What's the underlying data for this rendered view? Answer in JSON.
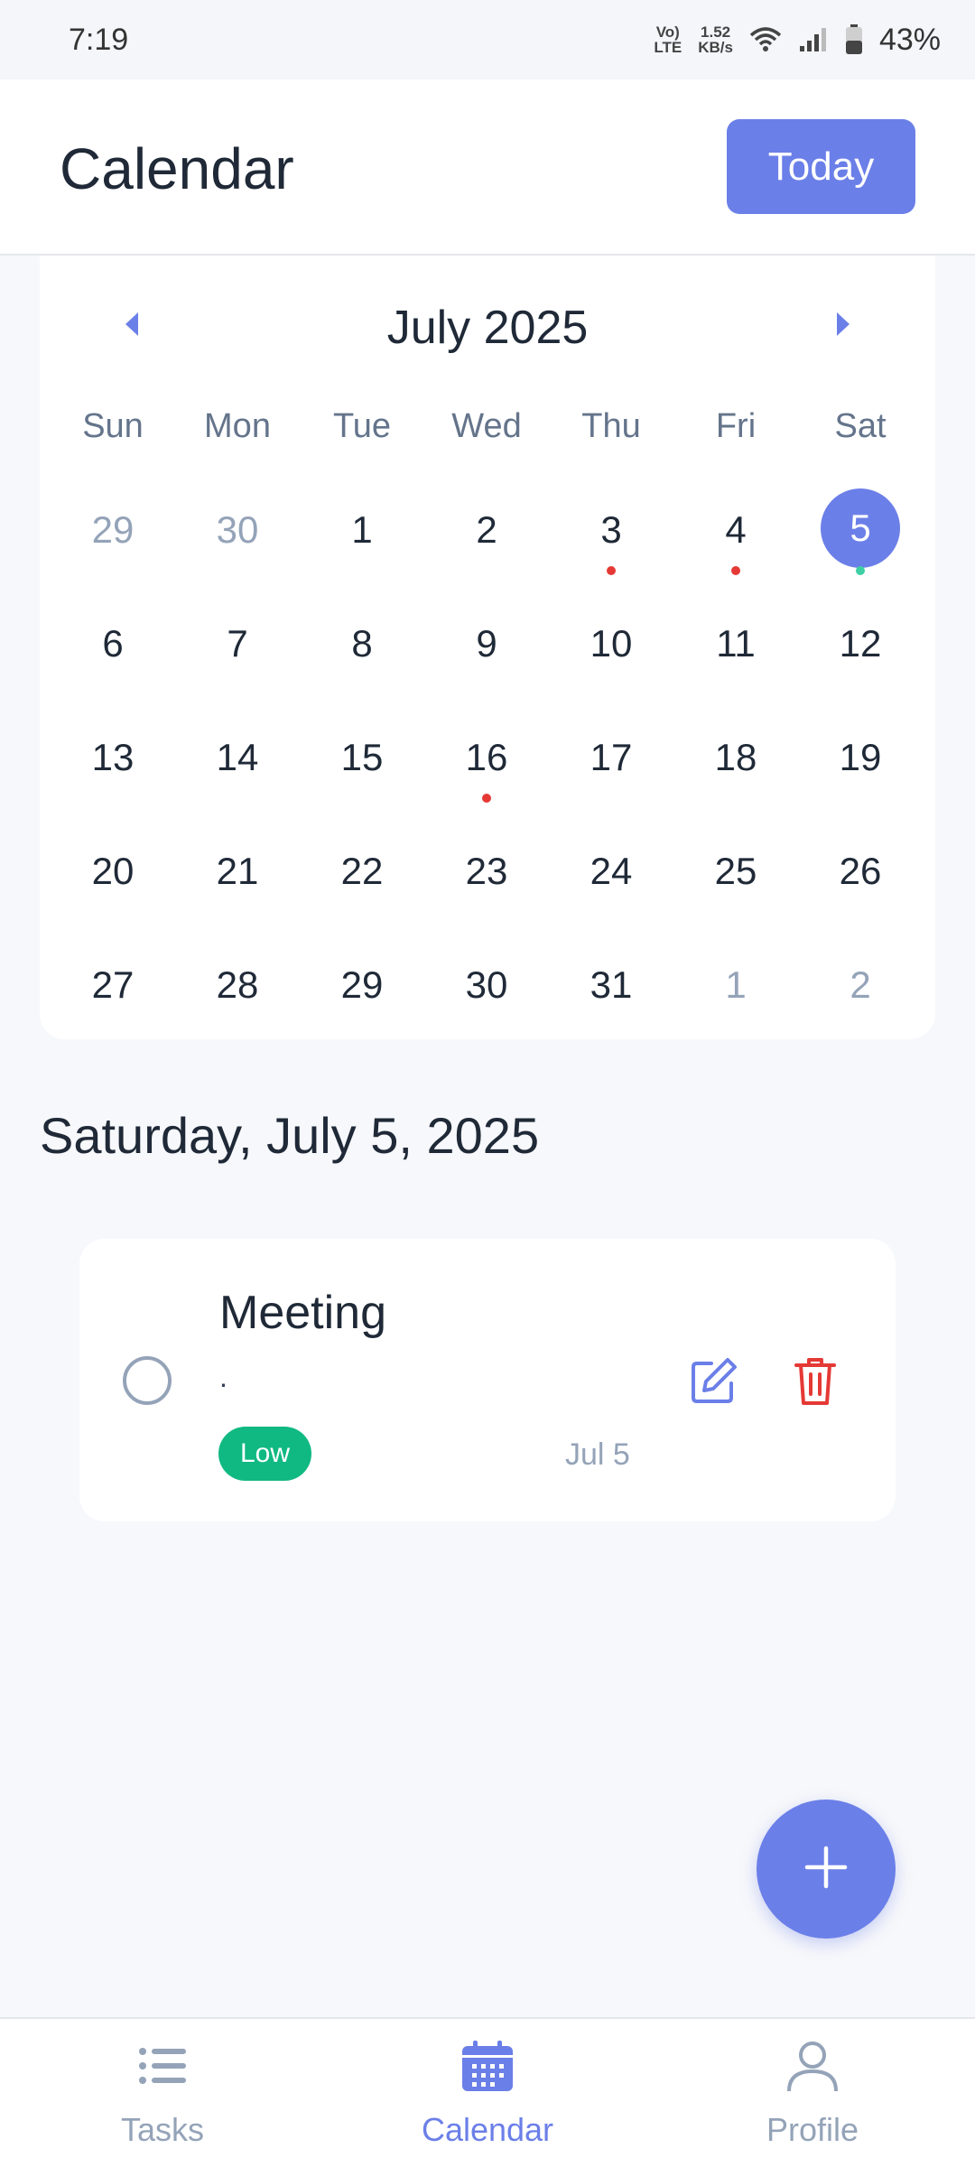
{
  "status_bar": {
    "time": "7:19",
    "network_type_top": "Vo)",
    "network_type_bottom": "LTE",
    "speed_top": "1.52",
    "speed_bottom": "KB/s",
    "battery": "43%"
  },
  "header": {
    "title": "Calendar",
    "today_label": "Today"
  },
  "calendar": {
    "month_label": "July 2025",
    "weekdays": [
      "Sun",
      "Mon",
      "Tue",
      "Wed",
      "Thu",
      "Fri",
      "Sat"
    ],
    "days": [
      {
        "label": "29",
        "muted": true
      },
      {
        "label": "30",
        "muted": true
      },
      {
        "label": "1"
      },
      {
        "label": "2"
      },
      {
        "label": "3",
        "dot": "red"
      },
      {
        "label": "4",
        "dot": "red"
      },
      {
        "label": "5",
        "selected": true,
        "dot": "teal"
      },
      {
        "label": "6"
      },
      {
        "label": "7"
      },
      {
        "label": "8"
      },
      {
        "label": "9"
      },
      {
        "label": "10"
      },
      {
        "label": "11"
      },
      {
        "label": "12"
      },
      {
        "label": "13"
      },
      {
        "label": "14"
      },
      {
        "label": "15"
      },
      {
        "label": "16",
        "dot": "red"
      },
      {
        "label": "17"
      },
      {
        "label": "18"
      },
      {
        "label": "19"
      },
      {
        "label": "20"
      },
      {
        "label": "21"
      },
      {
        "label": "22"
      },
      {
        "label": "23"
      },
      {
        "label": "24"
      },
      {
        "label": "25"
      },
      {
        "label": "26"
      },
      {
        "label": "27"
      },
      {
        "label": "28"
      },
      {
        "label": "29"
      },
      {
        "label": "30"
      },
      {
        "label": "31"
      },
      {
        "label": "1",
        "muted": true
      },
      {
        "label": "2",
        "muted": true
      }
    ]
  },
  "selected_date": "Saturday, July 5, 2025",
  "task": {
    "title": "Meeting",
    "description": ".",
    "priority": "Low",
    "date": "Jul 5"
  },
  "bottom_nav": {
    "tasks": "Tasks",
    "calendar": "Calendar",
    "profile": "Profile"
  },
  "colors": {
    "accent": "#6b7fe8",
    "priority_low": "#10b981",
    "delete": "#e53935",
    "event_dot": "#e53935",
    "selected_dot": "#3ecfa5"
  },
  "icons": [
    "chevron-left-icon",
    "chevron-right-icon",
    "edit-icon",
    "trash-icon",
    "plus-icon",
    "list-icon",
    "calendar-icon",
    "user-icon",
    "wifi-icon",
    "signal-icon",
    "battery-icon"
  ]
}
